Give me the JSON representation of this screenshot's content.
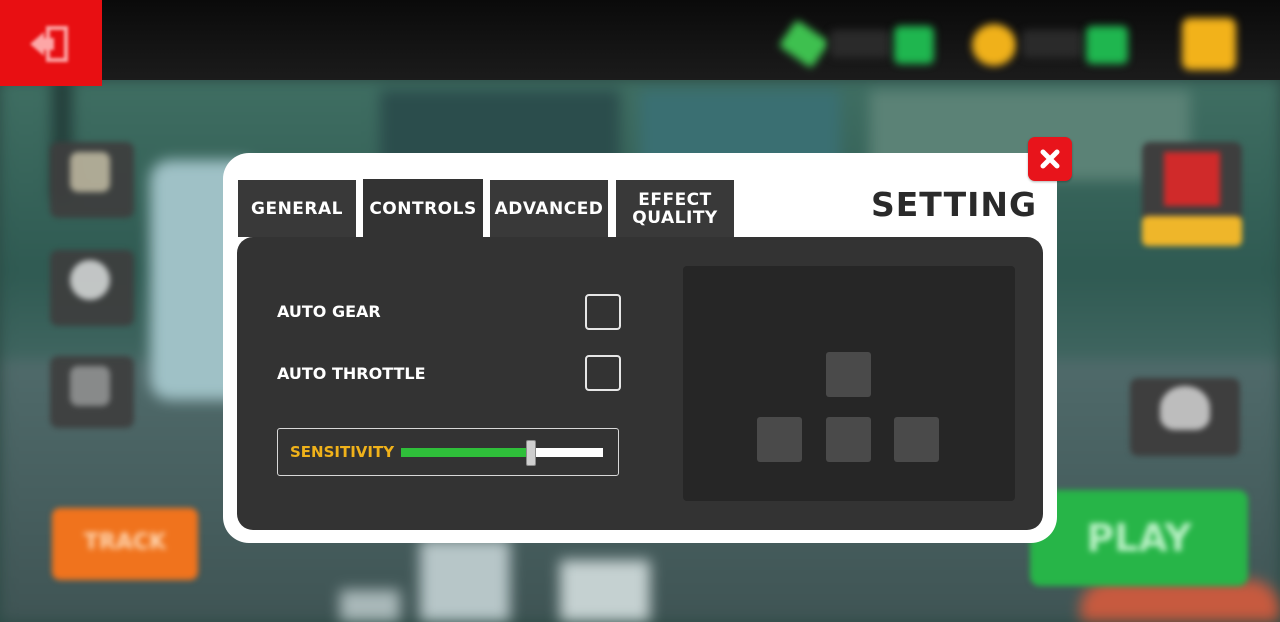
{
  "settings": {
    "title": "SETTING",
    "tabs": [
      {
        "label": "GENERAL",
        "active": false
      },
      {
        "label": "CONTROLS",
        "active": true
      },
      {
        "label": "ADVANCED",
        "active": false
      },
      {
        "label": "EFFECT QUALITY",
        "active": false
      }
    ],
    "controls": {
      "auto_gear": {
        "label": "AUTO GEAR",
        "checked": false
      },
      "auto_throttle": {
        "label": "AUTO THROTTLE",
        "checked": false
      },
      "sensitivity": {
        "label": "SENSITIVITY",
        "value": 0.64
      }
    }
  },
  "background_buttons": {
    "track_label": "TRACK",
    "play_label": "PLAY"
  },
  "colors": {
    "accent_red": "#e8141b",
    "slider_green": "#2fbf3a",
    "sensitivity_yellow": "#f0b21a",
    "panel_dark": "#333333",
    "play_green": "#27b548",
    "track_orange": "#f0731d"
  },
  "icons": {
    "back": "exit-door-icon",
    "close": "close-x-icon",
    "cash": "cash-icon",
    "coin": "coin-icon",
    "settings": "gear-icon",
    "trophy": "trophy-icon",
    "gift": "gift-icon",
    "helmet": "helmet-icon"
  }
}
